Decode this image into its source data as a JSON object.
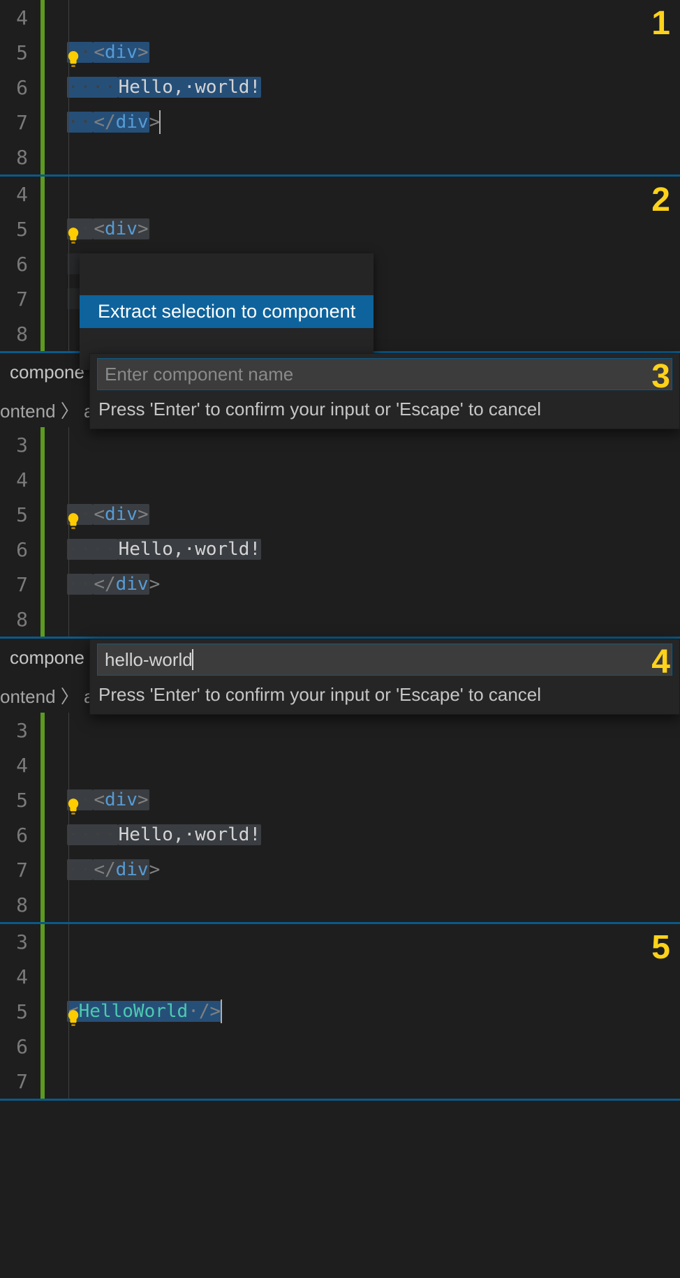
{
  "steps": [
    "1",
    "2",
    "3",
    "4",
    "5"
  ],
  "lines": {
    "l4": "4",
    "l5": "5",
    "l6": "6",
    "l7": "7",
    "l8": "8",
    "l3": "3"
  },
  "code": {
    "indent1": "··",
    "indent2": "····",
    "div_open_lt": "<",
    "div": "div",
    "gt": ">",
    "div_close_lt": "</",
    "text": "Hello,·world!",
    "comp_open_lt": "<",
    "comp_name": "HelloWorld",
    "comp_selfclose": "·/>"
  },
  "action": {
    "label": "Extract selection to component"
  },
  "tab": {
    "label": "compone"
  },
  "breadcrumb": {
    "label": "ontend 〉 a"
  },
  "input": {
    "placeholder": "Enter component name",
    "hint": "Press 'Enter' to confirm your input or 'Escape' to cancel",
    "value": "hello-world"
  }
}
